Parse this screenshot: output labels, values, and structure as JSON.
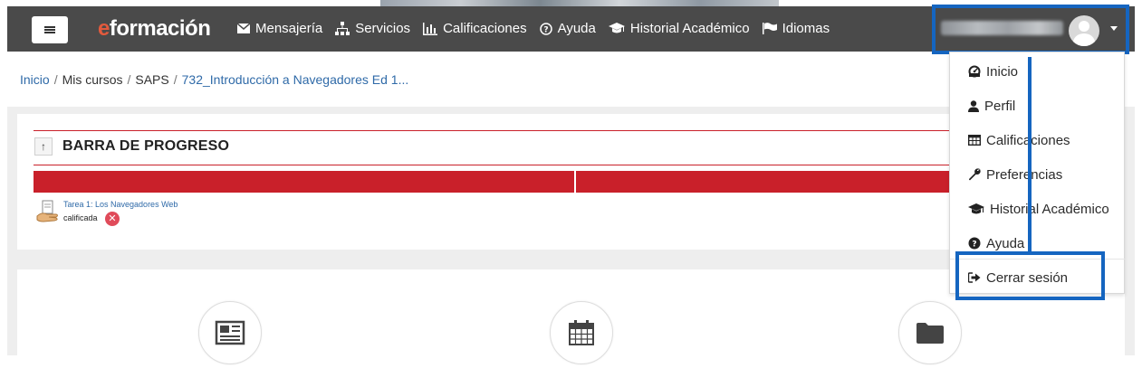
{
  "navbar": {
    "brand_e": "e",
    "brand_text": "formación",
    "items": [
      {
        "label": "Mensajería",
        "icon": "envelope-icon"
      },
      {
        "label": "Servicios",
        "icon": "sitemap-icon"
      },
      {
        "label": "Calificaciones",
        "icon": "bar-chart-icon"
      },
      {
        "label": "Ayuda",
        "icon": "question-circle-icon"
      },
      {
        "label": "Historial Académico",
        "icon": "graduation-cap-icon"
      },
      {
        "label": "Idiomas",
        "icon": "flag-icon"
      }
    ]
  },
  "breadcrumb": {
    "items": [
      "Inicio",
      "Mis cursos",
      "SAPS",
      "732_Introducción a Navegadores Ed 1..."
    ],
    "separator": "/"
  },
  "progress_block": {
    "collapse_glyph": "↑",
    "title": "BARRA DE PROGRESO",
    "task_link": "Tarea 1: Los Navegadores Web",
    "task_status": "calificada",
    "fail_glyph": "✕"
  },
  "user_menu": {
    "items": [
      {
        "label": "Inicio",
        "icon": "dashboard-icon"
      },
      {
        "label": "Perfil",
        "icon": "user-icon"
      },
      {
        "label": "Calificaciones",
        "icon": "table-icon"
      },
      {
        "label": "Preferencias",
        "icon": "wrench-icon"
      },
      {
        "label": "Historial Académico",
        "icon": "graduation-cap-icon"
      },
      {
        "label": "Ayuda",
        "icon": "question-circle-icon"
      },
      {
        "label": "Cerrar sesión",
        "icon": "sign-out-icon"
      }
    ]
  },
  "colors": {
    "navbar_bg": "#4a4a4a",
    "brand_accent": "#e35a3d",
    "progress_red": "#c9202a",
    "link_blue": "#2f6aa8",
    "highlight_blue": "#1565c0"
  }
}
